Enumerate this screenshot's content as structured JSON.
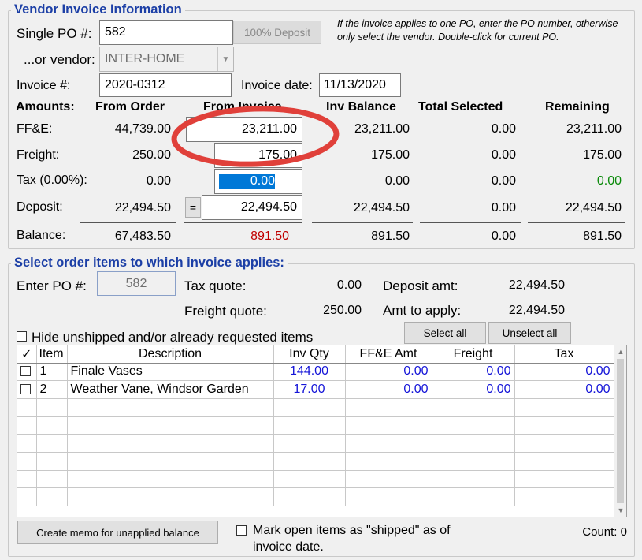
{
  "vendor_section": {
    "legend": "Vendor Invoice Information",
    "single_po_label": "Single PO #:",
    "single_po_value": "582",
    "deposit_button": "100% Deposit",
    "vendor_label": "...or vendor:",
    "vendor_value": "INTER-HOME",
    "note": "If the invoice applies to one PO, enter the PO number, otherwise only select the vendor. Double-click for current PO.",
    "invoice_num_label": "Invoice #:",
    "invoice_num_value": "2020-0312",
    "invoice_date_label": "Invoice date:",
    "invoice_date_value": "11/13/2020"
  },
  "amounts": {
    "headers": {
      "amounts": "Amounts:",
      "from_order": "From Order",
      "from_invoice": "From Invoice",
      "inv_balance": "Inv Balance",
      "total_selected": "Total Selected",
      "remaining": "Remaining"
    },
    "rows": {
      "ffe": {
        "label": "FF&E:",
        "from_order": "44,739.00",
        "from_invoice": "23,211.00",
        "inv_balance": "23,211.00",
        "total_selected": "0.00",
        "remaining": "23,211.00"
      },
      "freight": {
        "label": "Freight:",
        "from_order": "250.00",
        "from_invoice": "175.00",
        "inv_balance": "175.00",
        "total_selected": "0.00",
        "remaining": "175.00"
      },
      "tax": {
        "label": "Tax (0.00%):",
        "from_order": "0.00",
        "from_invoice": "0.00",
        "inv_balance": "0.00",
        "total_selected": "0.00",
        "remaining": "0.00"
      },
      "deposit": {
        "label": "Deposit:",
        "from_order": "22,494.50",
        "equals_button": "=",
        "from_invoice": "22,494.50",
        "inv_balance": "22,494.50",
        "total_selected": "0.00",
        "remaining": "22,494.50"
      },
      "balance": {
        "label": "Balance:",
        "from_order": "67,483.50",
        "from_invoice": "891.50",
        "inv_balance": "891.50",
        "total_selected": "0.00",
        "remaining": "891.50"
      }
    }
  },
  "order_section": {
    "legend": "Select order items to which invoice applies:",
    "enter_po_label": "Enter PO #:",
    "enter_po_value": "582",
    "tax_quote_label": "Tax quote:",
    "tax_quote_value": "0.00",
    "freight_quote_label": "Freight quote:",
    "freight_quote_value": "250.00",
    "deposit_amt_label": "Deposit amt:",
    "deposit_amt_value": "22,494.50",
    "amt_to_apply_label": "Amt to apply:",
    "amt_to_apply_value": "22,494.50",
    "hide_unshipped_label": "Hide unshipped and/or already requested items",
    "select_all": "Select all",
    "unselect_all": "Unselect all"
  },
  "grid": {
    "columns": [
      "✓",
      "Item",
      "Description",
      "Inv Qty",
      "FF&E Amt",
      "Freight",
      "Tax"
    ],
    "rows": [
      {
        "item": "1",
        "description": "Finale Vases",
        "inv_qty": "144.00",
        "ffe_amt": "0.00",
        "freight": "0.00",
        "tax": "0.00"
      },
      {
        "item": "2",
        "description": "Weather Vane, Windsor Garden",
        "inv_qty": "17.00",
        "ffe_amt": "0.00",
        "freight": "0.00",
        "tax": "0.00"
      }
    ],
    "empty_rows": 6
  },
  "footer": {
    "memo_button": "Create memo for unapplied balance",
    "mark_shipped_label_1": "Mark open items as \"shipped\" as of",
    "mark_shipped_label_2": "invoice date.",
    "count_text": "Count: 0"
  },
  "colors": {
    "legend": "#1c3fa6",
    "balance_red": "#c00000",
    "remaining_green": "#0a8a0a",
    "grid_values_blue": "#1515d8",
    "highlight_ring": "#e0403a",
    "selection_blue": "#0078d7"
  }
}
